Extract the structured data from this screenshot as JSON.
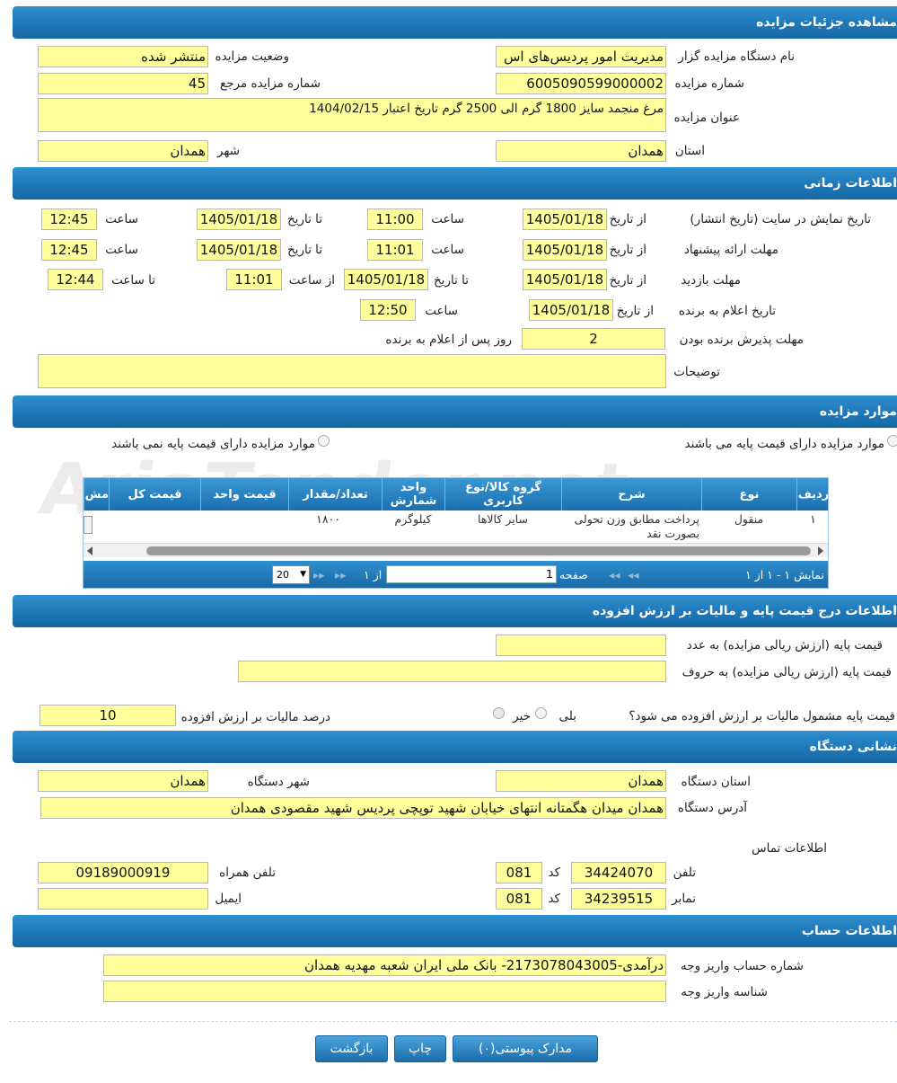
{
  "sections": {
    "details": "مشاهده جزئیات مزایده",
    "time": "اطلاعات زمانی",
    "items": "موارد مزایده",
    "price": "اطلاعات درج قیمت پایه و مالیات بر ارزش افزوده",
    "address": "نشانی دستگاه",
    "account": "اطلاعات حساب"
  },
  "details": {
    "org_label": "نام دستگاه مزایده گزار",
    "org_value": "مدیریت امور پردیس‌های اس",
    "status_label": "وضعیت مزایده",
    "status_value": "منتشر شده",
    "number_label": "شماره مزایده",
    "number_value": "6005090599000002",
    "ref_label": "شماره مزایده مرجع",
    "ref_value": "45",
    "title_label": "عنوان مزایده",
    "title_value": "مرغ منجمد سایز 1800 گرم الی 2500 گرم تاریخ اعتبار 1404/02/15",
    "province_label": "استان",
    "province_value": "همدان",
    "city_label": "شهر",
    "city_value": "همدان"
  },
  "time": {
    "from_date": "از تاریخ",
    "to_date": "تا تاریخ",
    "hour": "ساعت",
    "from_hour": "از ساعت",
    "to_hour": "تا ساعت",
    "publish_label": "تاریخ نمایش در سایت (تاریخ انتشار)",
    "publish_from_date": "1405/01/18",
    "publish_from_time": "11:00",
    "publish_to_date": "1405/01/18",
    "publish_to_time": "12:45",
    "offer_label": "مهلت ارائه پیشنهاد",
    "offer_from_date": "1405/01/18",
    "offer_from_time": "11:01",
    "offer_to_date": "1405/01/18",
    "offer_to_time": "12:45",
    "visit_label": "مهلت بازدید",
    "visit_from_date": "1405/01/18",
    "visit_to_date": "1405/01/18",
    "visit_from_time": "11:01",
    "visit_to_time": "12:44",
    "announce_label": "تاریخ اعلام به برنده",
    "announce_date": "1405/01/18",
    "announce_time": "12:50",
    "accept_label": "مهلت پذیرش برنده بودن",
    "accept_value": "2",
    "accept_suffix": "روز پس از اعلام به برنده",
    "desc_label": "توضیحات",
    "desc_value": ""
  },
  "items": {
    "radio_with_price": "موارد مزایده دارای قیمت پایه می باشند",
    "radio_without_price": "موارد مزایده دارای قیمت پایه نمی باشند",
    "columns": [
      "ردیف",
      "نوع",
      "شرح",
      "گروه کالا/نوع کاربری",
      "واحد شمارش",
      "تعداد/مقدار",
      "قیمت واحد",
      "قیمت کل",
      "مش"
    ],
    "row": {
      "index": "۱",
      "type": "منقول",
      "desc": "پرداخت مطابق وزن تحولی بصورت نقد",
      "group": "سایر کالاها",
      "unit": "کیلوگرم",
      "qty": "۱۸۰۰"
    },
    "pager": {
      "showing": "نمایش ۱ - ۱ از ۱",
      "page_label": "صفحه",
      "page_value": "1",
      "of_label": "از ۱",
      "page_size": "20"
    }
  },
  "price": {
    "base_num_label": "قیمت پایه (ارزش ریالی مزایده) به عدد",
    "base_num_value": "",
    "base_text_label": "قیمت پایه (ارزش ریالی مزایده) به حروف",
    "base_text_value": "",
    "vat_question": "قیمت پایه مشمول مالیات بر ارزش افزوده می شود؟",
    "yes": "بلی",
    "no": "خیر",
    "vat_percent_label": "درصد مالیات بر ارزش افزوده",
    "vat_percent_value": "10"
  },
  "address": {
    "province_label": "استان دستگاه",
    "province_value": "همدان",
    "city_label": "شهر دستگاه",
    "city_value": "همدان",
    "address_label": "آدرس دستگاه",
    "address_value": "همدان میدان هگمتانه انتهای خیابان شهید توپچی پردیس شهید مقصودی همدان",
    "contact_label": "اطلاعات تماس",
    "phone_label": "تلفن",
    "phone_value": "34424070",
    "code_label": "کد",
    "phone_code": "081",
    "mobile_label": "تلفن همراه",
    "mobile_value": "09189000919",
    "fax_label": "نمابر",
    "fax_value": "34239515",
    "fax_code": "081",
    "email_label": "ایمیل",
    "email_value": ""
  },
  "account": {
    "account_label": "شماره حساب واریز وجه",
    "account_value": "درآمدی-2173078043005- بانک ملی ایران شعبه مهدیه همدان",
    "id_label": "شناسه واریز وجه",
    "id_value": ""
  },
  "buttons": {
    "attachments": "مدارک پیوستی(۰)",
    "print": "چاپ",
    "back": "بازگشت"
  },
  "watermark": "AriaTender.net"
}
